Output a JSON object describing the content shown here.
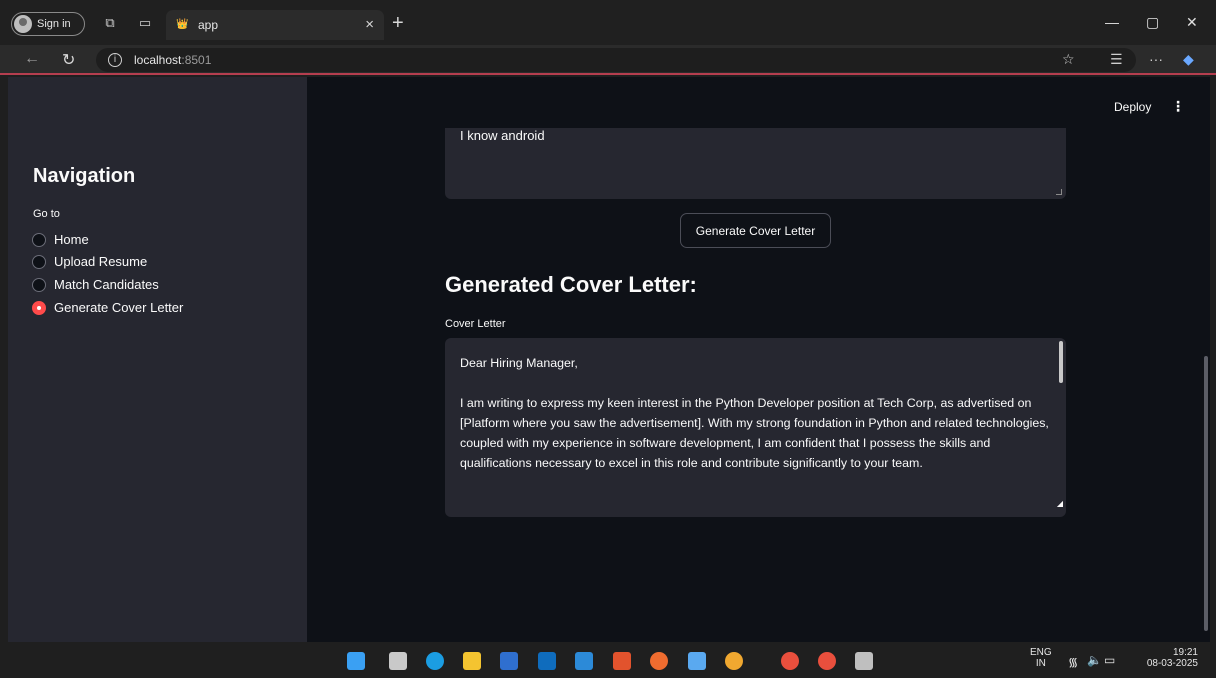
{
  "browser": {
    "signin_label": "Sign in",
    "tab_title": "app",
    "close_label": "×",
    "newtab_label": "+",
    "url_host": "localhost",
    "url_port": ":8501",
    "window_controls": [
      "—",
      "▢",
      "✕"
    ]
  },
  "header": {
    "deploy_label": "Deploy",
    "menu_label": "⋮"
  },
  "sidebar": {
    "heading": "Navigation",
    "goto_label": "Go to",
    "options": [
      {
        "label": "Home",
        "selected": false
      },
      {
        "label": "Upload Resume",
        "selected": false
      },
      {
        "label": "Match Candidates",
        "selected": false
      },
      {
        "label": "Generate Cover Letter",
        "selected": true
      }
    ]
  },
  "main": {
    "input_text": "I know android",
    "generate_button": "Generate Cover Letter",
    "generated_heading": "Generated Cover Letter:",
    "cover_letter_label": "Cover Letter",
    "cover_letter_para1": "Dear Hiring Manager,",
    "cover_letter_para2": "I am writing to express my keen interest in the Python Developer position at Tech Corp, as advertised on [Platform where you saw the advertisement]. With my strong foundation in Python and related technologies, coupled with my experience in software development, I am confident that I possess the skills and qualifications necessary to excel in this role and contribute significantly to your team."
  },
  "taskbar": {
    "lang_top": "ENG",
    "lang_bottom": "IN",
    "time": "19:21",
    "date": "08-03-2025",
    "icons": [
      "windows-start",
      "task-view",
      "edge",
      "file-explorer",
      "store",
      "outlook",
      "vscode",
      "xampp",
      "postman",
      "notepad",
      "chrome",
      "chrome-profile-a",
      "chrome-profile-b",
      "database"
    ]
  },
  "colors": {
    "accent": "#ff4b4b",
    "app_bg": "#0e1117",
    "sidebar_bg": "#262730"
  }
}
